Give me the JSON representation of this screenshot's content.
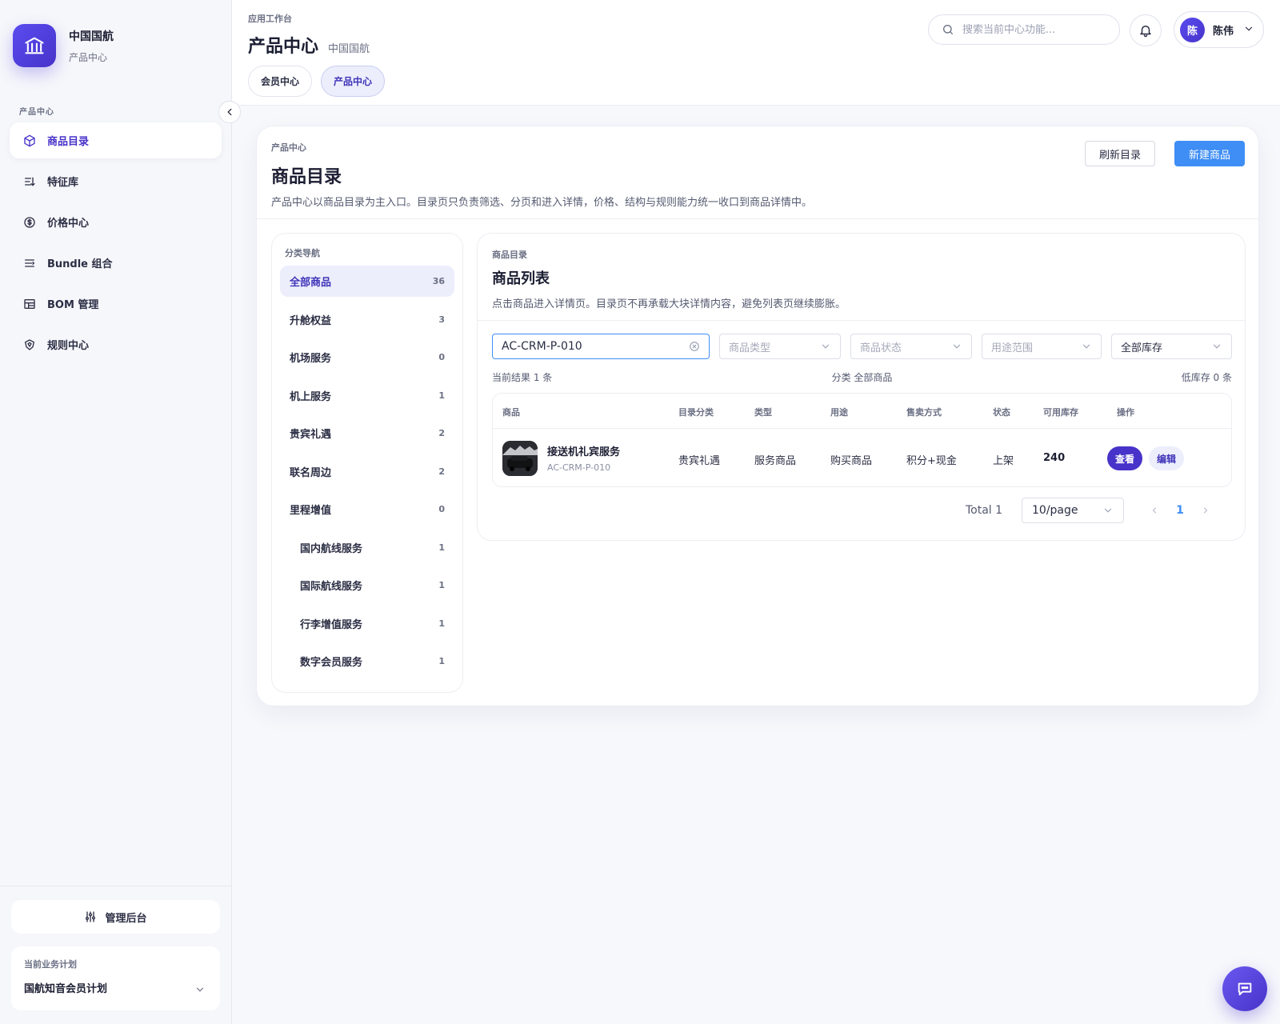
{
  "brand": {
    "name": "中国国航",
    "subtitle": "产品中心"
  },
  "sidebar": {
    "section_label": "产品中心",
    "items": [
      {
        "label": "商品目录",
        "icon": "box-icon",
        "active": true
      },
      {
        "label": "特征库",
        "icon": "sort-icon",
        "active": false
      },
      {
        "label": "价格中心",
        "icon": "dollar-icon",
        "active": false
      },
      {
        "label": "Bundle 组合",
        "icon": "list-icon",
        "active": false
      },
      {
        "label": "BOM 管理",
        "icon": "grid-icon",
        "active": false
      },
      {
        "label": "规则中心",
        "icon": "shield-icon",
        "active": false
      }
    ],
    "admin_label": "管理后台",
    "plan": {
      "label": "当前业务计划",
      "value": "国航知音会员计划"
    }
  },
  "header": {
    "breadcrumb": "应用工作台",
    "title": "产品中心",
    "subtitle": "中国国航",
    "tabs": [
      {
        "label": "会员中心",
        "active": false
      },
      {
        "label": "产品中心",
        "active": true
      }
    ],
    "search_placeholder": "搜索当前中心功能...",
    "user": {
      "avatar": "陈",
      "name": "陈伟"
    }
  },
  "main": {
    "label": "产品中心",
    "title": "商品目录",
    "description": "产品中心以商品目录为主入口。目录页只负责筛选、分页和进入详情，价格、结构与规则能力统一收口到商品详情中。",
    "refresh_label": "刷新目录",
    "new_label": "新建商品"
  },
  "categories": {
    "label": "分类导航",
    "items": [
      {
        "label": "全部商品",
        "count": "36",
        "active": true,
        "sub": false
      },
      {
        "label": "升舱权益",
        "count": "3",
        "active": false,
        "sub": false
      },
      {
        "label": "机场服务",
        "count": "0",
        "active": false,
        "sub": false
      },
      {
        "label": "机上服务",
        "count": "1",
        "active": false,
        "sub": false
      },
      {
        "label": "贵宾礼遇",
        "count": "2",
        "active": false,
        "sub": false
      },
      {
        "label": "联名周边",
        "count": "2",
        "active": false,
        "sub": false
      },
      {
        "label": "里程增值",
        "count": "0",
        "active": false,
        "sub": false
      },
      {
        "label": "国内航线服务",
        "count": "1",
        "active": false,
        "sub": true
      },
      {
        "label": "国际航线服务",
        "count": "1",
        "active": false,
        "sub": true
      },
      {
        "label": "行李增值服务",
        "count": "1",
        "active": false,
        "sub": true
      },
      {
        "label": "数字会员服务",
        "count": "1",
        "active": false,
        "sub": true
      }
    ]
  },
  "list": {
    "label": "商品目录",
    "title": "商品列表",
    "description": "点击商品进入详情页。目录页不再承载大块详情内容，避免列表页继续膨胀。",
    "filters": {
      "search_value": "AC-CRM-P-010",
      "type_placeholder": "商品类型",
      "status_placeholder": "商品状态",
      "scope_placeholder": "用途范围",
      "stock_value": "全部库存"
    },
    "meta": {
      "result": "当前结果 1 条",
      "category": "分类 全部商品",
      "low_stock": "低库存 0 条"
    },
    "columns": [
      "商品",
      "目录分类",
      "类型",
      "用途",
      "售卖方式",
      "状态",
      "可用库存",
      "操作"
    ],
    "rows": [
      {
        "name": "接送机礼宾服务",
        "code": "AC-CRM-P-010",
        "category": "贵宾礼遇",
        "type": "服务商品",
        "usage": "购买商品",
        "sale_mode": "积分+现金",
        "status": "上架",
        "stock": "240",
        "view_label": "查看",
        "edit_label": "编辑"
      }
    ],
    "pager": {
      "total": "Total 1",
      "page_size": "10/page",
      "current_page": "1"
    }
  },
  "colors": {
    "primary": "#4733c9",
    "accent_blue": "#3f8ef5"
  }
}
